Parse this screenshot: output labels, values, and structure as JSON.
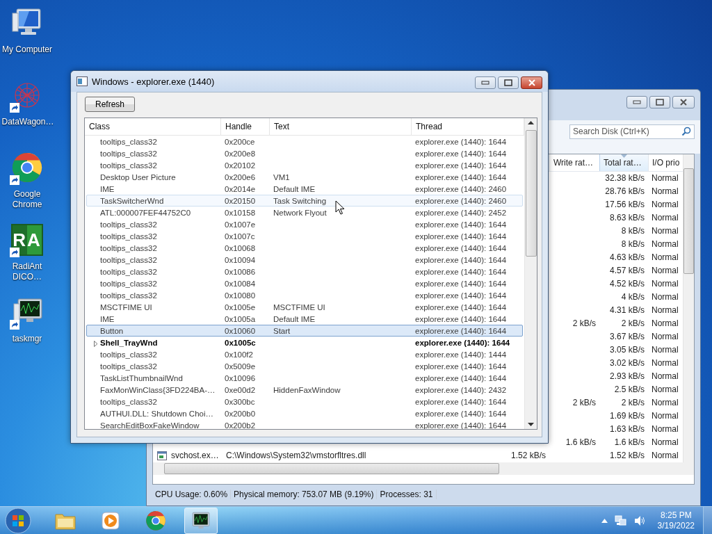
{
  "desktop_icons": [
    {
      "label": "My Computer",
      "kind": "computer",
      "shortcut": false
    },
    {
      "label": "DataWagon…",
      "kind": "network",
      "shortcut": true
    },
    {
      "label": "Google Chrome",
      "kind": "chrome",
      "shortcut": true
    },
    {
      "label": "RadiAnt DICO…",
      "kind": "logo",
      "logo_text": "RA",
      "shortcut": true
    },
    {
      "label": "taskmgr",
      "kind": "monitor",
      "shortcut": true
    }
  ],
  "disk_window": {
    "search": {
      "placeholder": "Search Disk (Ctrl+K)"
    },
    "columns": [
      {
        "label": "Write rat…",
        "sorted": false
      },
      {
        "label": "Total rat…",
        "sorted": true
      },
      {
        "label": "I/O prio",
        "sorted": false
      }
    ],
    "rows": [
      {
        "total_rate": "32.38 kB/s",
        "io_priority": "Normal"
      },
      {
        "total_rate": "28.76 kB/s",
        "io_priority": "Normal"
      },
      {
        "total_rate": "17.56 kB/s",
        "io_priority": "Normal"
      },
      {
        "total_rate": "8.63 kB/s",
        "io_priority": "Normal"
      },
      {
        "total_rate": "8 kB/s",
        "io_priority": "Normal"
      },
      {
        "total_rate": "8 kB/s",
        "io_priority": "Normal"
      },
      {
        "total_rate": "4.63 kB/s",
        "io_priority": "Normal"
      },
      {
        "total_rate": "4.57 kB/s",
        "io_priority": "Normal"
      },
      {
        "total_rate": "4.52 kB/s",
        "io_priority": "Normal"
      },
      {
        "total_rate": "4 kB/s",
        "io_priority": "Normal"
      },
      {
        "total_rate": "4.31 kB/s",
        "io_priority": "Normal"
      },
      {
        "write_rate": "2 kB/s",
        "total_rate": "2 kB/s",
        "io_priority": "Normal"
      },
      {
        "total_rate": "3.67 kB/s",
        "io_priority": "Normal"
      },
      {
        "total_rate": "3.05 kB/s",
        "io_priority": "Normal"
      },
      {
        "total_rate": "3.02 kB/s",
        "io_priority": "Normal"
      },
      {
        "total_rate": "2.93 kB/s",
        "io_priority": "Normal"
      },
      {
        "total_rate": "2.5 kB/s",
        "io_priority": "Normal"
      },
      {
        "write_rate": "2 kB/s",
        "total_rate": "2 kB/s",
        "io_priority": "Normal"
      },
      {
        "total_rate": "1.69 kB/s",
        "io_priority": "Normal"
      },
      {
        "total_rate": "1.63 kB/s",
        "io_priority": "Normal"
      },
      {
        "write_rate": "1.6 kB/s",
        "total_rate": "1.6 kB/s",
        "io_priority": "Normal"
      },
      {
        "process": "svchost.ex…",
        "file": "C:\\Windows\\System32\\vmstorfltres.dll",
        "column_3": "1.52 kB/s",
        "total_rate": "1.52 kB/s",
        "io_priority": "Normal"
      }
    ],
    "status_bar": [
      "CPU Usage: 0.60%",
      "Physical memory: 753.07 MB (9.19%)",
      "Processes: 31"
    ]
  },
  "windows_dialog": {
    "title": "Windows - explorer.exe (1440)",
    "refresh_button": "Refresh",
    "columns": [
      "Class",
      "Handle",
      "Text",
      "Thread"
    ],
    "rows": [
      {
        "class": "tooltips_class32",
        "handle": "0x200ce",
        "thread": "explorer.exe (1440): 1644",
        "selected": false,
        "hovered": false,
        "expandable": false
      },
      {
        "class": "tooltips_class32",
        "handle": "0x200e8",
        "thread": "explorer.exe (1440): 1644",
        "selected": false,
        "hovered": false,
        "expandable": false
      },
      {
        "class": "tooltips_class32",
        "handle": "0x20102",
        "thread": "explorer.exe (1440): 1644",
        "selected": false,
        "hovered": false,
        "expandable": false
      },
      {
        "class": "Desktop User Picture",
        "handle": "0x200e6",
        "text": "VM1",
        "thread": "explorer.exe (1440): 1644",
        "selected": false,
        "hovered": false,
        "expandable": false
      },
      {
        "class": "IME",
        "handle": "0x2014e",
        "text": "Default IME",
        "thread": "explorer.exe (1440): 2460",
        "selected": false,
        "hovered": false,
        "expandable": false
      },
      {
        "class": "TaskSwitcherWnd",
        "handle": "0x20150",
        "text": "Task Switching",
        "thread": "explorer.exe (1440): 2460",
        "selected": false,
        "hovered": true,
        "expandable": false
      },
      {
        "class": "ATL:000007FEF44752C0",
        "handle": "0x10158",
        "text": "Network Flyout",
        "thread": "explorer.exe (1440): 2452",
        "selected": false,
        "hovered": false,
        "expandable": false
      },
      {
        "class": "tooltips_class32",
        "handle": "0x1007e",
        "thread": "explorer.exe (1440): 1644",
        "selected": false,
        "hovered": false,
        "expandable": false
      },
      {
        "class": "tooltips_class32",
        "handle": "0x1007c",
        "thread": "explorer.exe (1440): 1644",
        "selected": false,
        "hovered": false,
        "expandable": false
      },
      {
        "class": "tooltips_class32",
        "handle": "0x10068",
        "thread": "explorer.exe (1440): 1644",
        "selected": false,
        "hovered": false,
        "expandable": false
      },
      {
        "class": "tooltips_class32",
        "handle": "0x10094",
        "thread": "explorer.exe (1440): 1644",
        "selected": false,
        "hovered": false,
        "expandable": false
      },
      {
        "class": "tooltips_class32",
        "handle": "0x10086",
        "thread": "explorer.exe (1440): 1644",
        "selected": false,
        "hovered": false,
        "expandable": false
      },
      {
        "class": "tooltips_class32",
        "handle": "0x10084",
        "thread": "explorer.exe (1440): 1644",
        "selected": false,
        "hovered": false,
        "expandable": false
      },
      {
        "class": "tooltips_class32",
        "handle": "0x10080",
        "thread": "explorer.exe (1440): 1644",
        "selected": false,
        "hovered": false,
        "expandable": false
      },
      {
        "class": "MSCTFIME UI",
        "handle": "0x1005e",
        "text": "MSCTFIME UI",
        "thread": "explorer.exe (1440): 1644",
        "selected": false,
        "hovered": false,
        "expandable": false
      },
      {
        "class": "IME",
        "handle": "0x1005a",
        "text": "Default IME",
        "thread": "explorer.exe (1440): 1644",
        "selected": false,
        "hovered": false,
        "expandable": false
      },
      {
        "class": "Button",
        "handle": "0x10060",
        "text": "Start",
        "thread": "explorer.exe (1440): 1644",
        "selected": true,
        "hovered": false,
        "expandable": false
      },
      {
        "class": "Shell_TrayWnd",
        "handle": "0x1005c",
        "thread": "explorer.exe (1440): 1644",
        "selected": false,
        "hovered": false,
        "expandable": true
      },
      {
        "class": "tooltips_class32",
        "handle": "0x100f2",
        "thread": "explorer.exe (1440): 1444",
        "selected": false,
        "hovered": false,
        "expandable": false
      },
      {
        "class": "tooltips_class32",
        "handle": "0x5009e",
        "thread": "explorer.exe (1440): 1644",
        "selected": false,
        "hovered": false,
        "expandable": false
      },
      {
        "class": "TaskListThumbnailWnd",
        "handle": "0x10096",
        "thread": "explorer.exe (1440): 1644",
        "selected": false,
        "hovered": false,
        "expandable": false
      },
      {
        "class": "FaxMonWinClass{3FD224BA-…",
        "handle": "0xe00d2",
        "text": "HiddenFaxWindow",
        "thread": "explorer.exe (1440): 2432",
        "selected": false,
        "hovered": false,
        "expandable": false
      },
      {
        "class": "tooltips_class32",
        "handle": "0x300bc",
        "thread": "explorer.exe (1440): 1644",
        "selected": false,
        "hovered": false,
        "expandable": false
      },
      {
        "class": "AUTHUI.DLL: Shutdown Choi…",
        "handle": "0x200b0",
        "thread": "explorer.exe (1440): 1644",
        "selected": false,
        "hovered": false,
        "expandable": false
      },
      {
        "class": "SearchEditBoxFakeWindow",
        "handle": "0x200b2",
        "thread": "explorer.exe (1440): 1644",
        "selected": false,
        "hovered": false,
        "expandable": false
      }
    ]
  },
  "taskbar": {
    "apps": [
      {
        "kind": "folder",
        "active": false
      },
      {
        "kind": "media",
        "active": false
      },
      {
        "kind": "chrome",
        "active": false
      },
      {
        "kind": "monitor",
        "active": true
      }
    ],
    "clock": {
      "time": "8:25 PM",
      "date": "3/19/2022"
    }
  }
}
